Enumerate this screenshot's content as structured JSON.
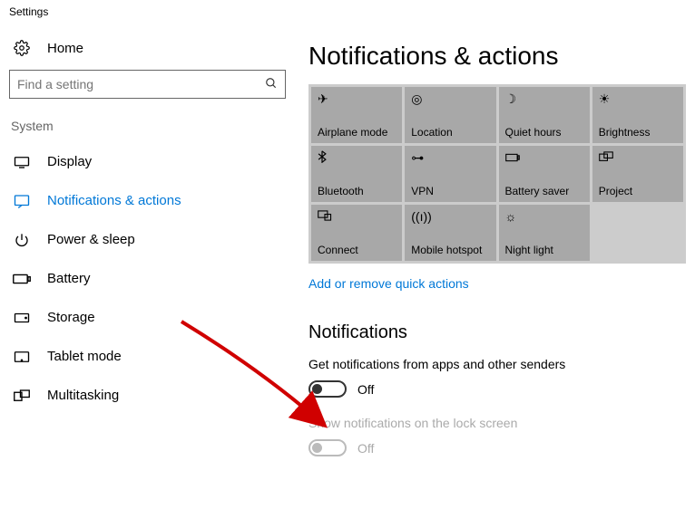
{
  "window_title": "Settings",
  "home_label": "Home",
  "search": {
    "placeholder": "Find a setting"
  },
  "sidebar": {
    "section": "System",
    "items": [
      {
        "label": "Display"
      },
      {
        "label": "Notifications & actions"
      },
      {
        "label": "Power & sleep"
      },
      {
        "label": "Battery"
      },
      {
        "label": "Storage"
      },
      {
        "label": "Tablet mode"
      },
      {
        "label": "Multitasking"
      }
    ]
  },
  "main": {
    "heading": "Notifications & actions",
    "quick_actions": [
      {
        "label": "Airplane mode"
      },
      {
        "label": "Location"
      },
      {
        "label": "Quiet hours"
      },
      {
        "label": "Brightness"
      },
      {
        "label": "Bluetooth"
      },
      {
        "label": "VPN"
      },
      {
        "label": "Battery saver"
      },
      {
        "label": "Project"
      },
      {
        "label": "Connect"
      },
      {
        "label": "Mobile hotspot"
      },
      {
        "label": "Night light"
      }
    ],
    "quick_actions_link": "Add or remove quick actions",
    "notifications_heading": "Notifications",
    "setting1": {
      "label": "Get notifications from apps and other senders",
      "state": "Off"
    },
    "setting2": {
      "label": "Show notifications on the lock screen",
      "state": "Off"
    }
  }
}
